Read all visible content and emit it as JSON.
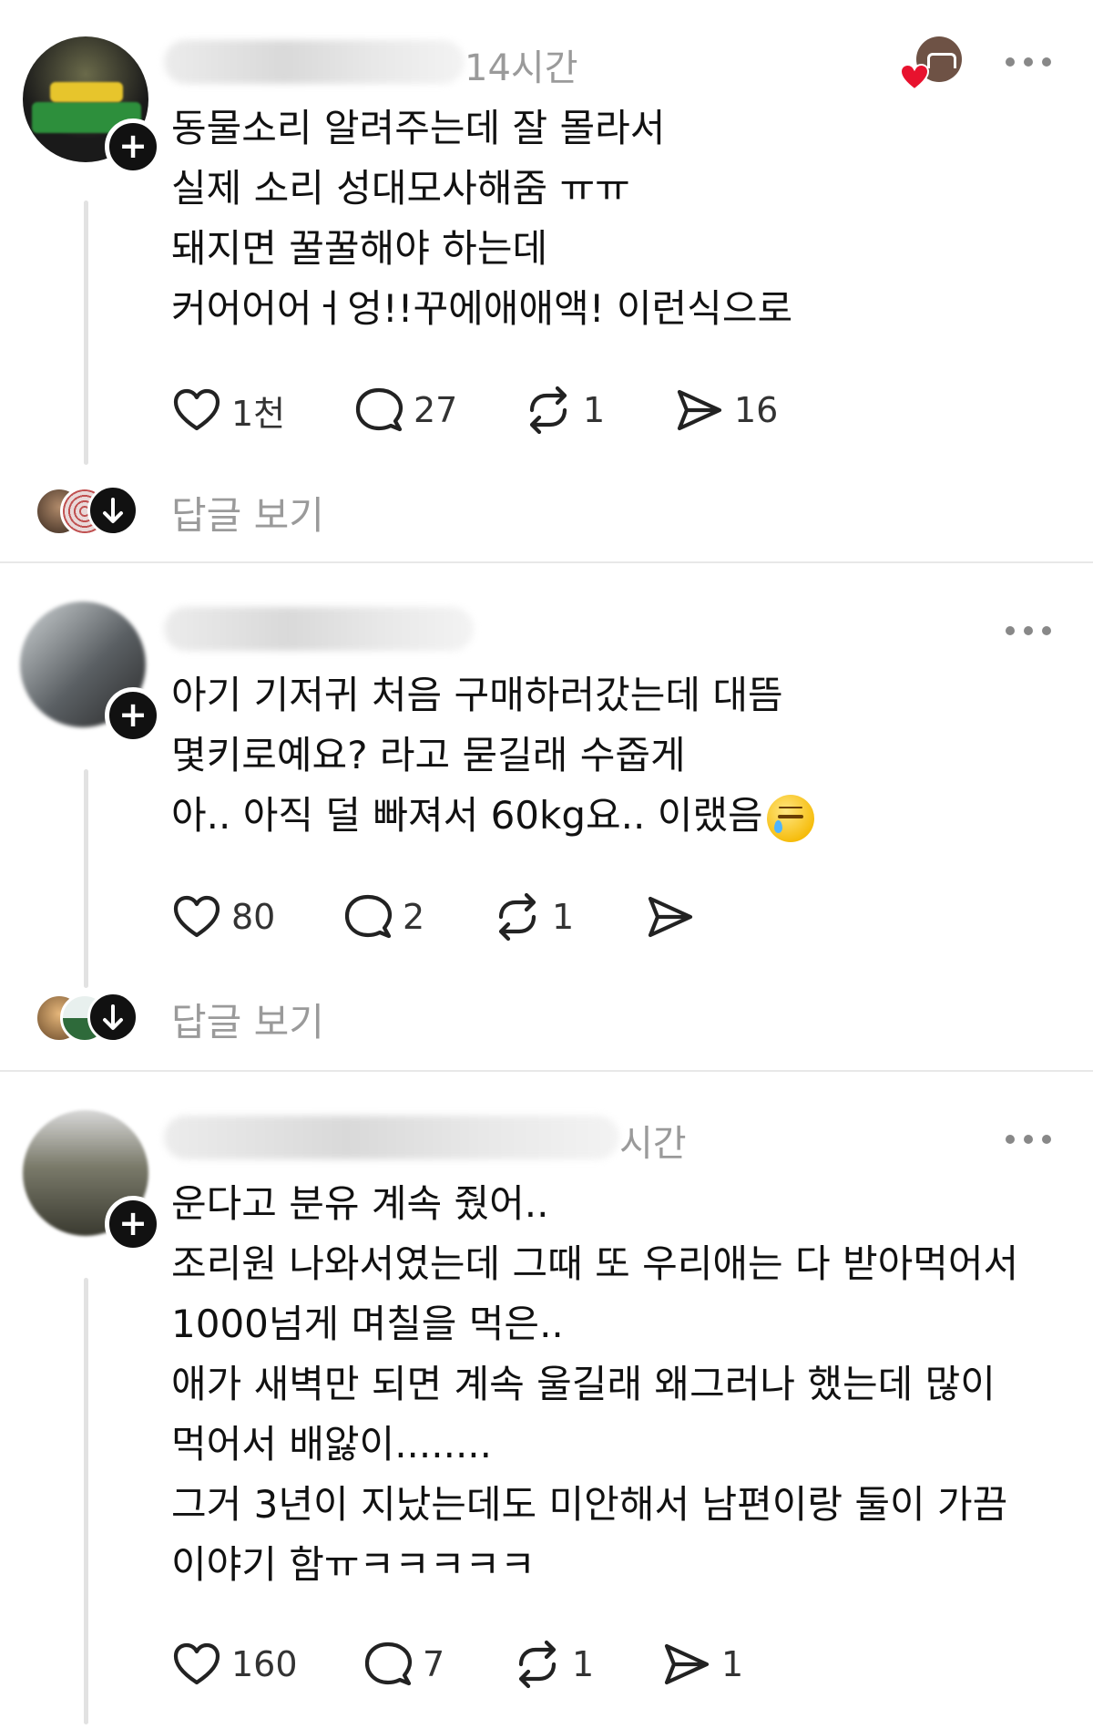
{
  "posts": [
    {
      "time": "14시간",
      "text": "동물소리 알려주는데 잘 몰라서\n실제 소리 성대모사해줌 ㅠㅠ\n돼지면 꿀꿀해야 하는데\n커어어어ㅓ엉!!꾸에애애액! 이런식으로",
      "likes": "1천",
      "comments": "27",
      "reposts": "1",
      "shares": "16",
      "view_replies": "답글 보기"
    },
    {
      "time": "",
      "text": "아기 기저귀 처음 구매하러갔는데 대뜸\n몇키로예요? 라고 묻길래 수줍게\n아.. 아직 덜 빠져서 60kg요.. 이랬음",
      "likes": "80",
      "comments": "2",
      "reposts": "1",
      "shares": "",
      "view_replies": "답글 보기"
    },
    {
      "time": "시간",
      "text": "운다고 분유 계속 줬어..\n조리원 나와서였는데 그때 또 우리애는 다 받아먹어서\n1000넘게 며칠을 먹은..\n애가 새벽만 되면 계속 울길래 왜그러나 했는데 많이\n먹어서 배앓이........\n그거 3년이 지났는데도 미안해서 남편이랑 둘이 가끔\n이야기 함ㅠㅋㅋㅋㅋㅋ",
      "likes": "160",
      "comments": "7",
      "reposts": "1",
      "shares": "1",
      "view_replies": ""
    }
  ],
  "icons": {
    "like": "heart-icon",
    "comment": "speech-bubble-icon",
    "repost": "repost-icon",
    "share": "send-icon",
    "more": "more-dots-icon",
    "follow": "plus-icon",
    "expand": "arrow-down-icon"
  },
  "colors": {
    "text": "#111111",
    "muted": "#9a9a9a",
    "heart_red": "#e8122e"
  }
}
